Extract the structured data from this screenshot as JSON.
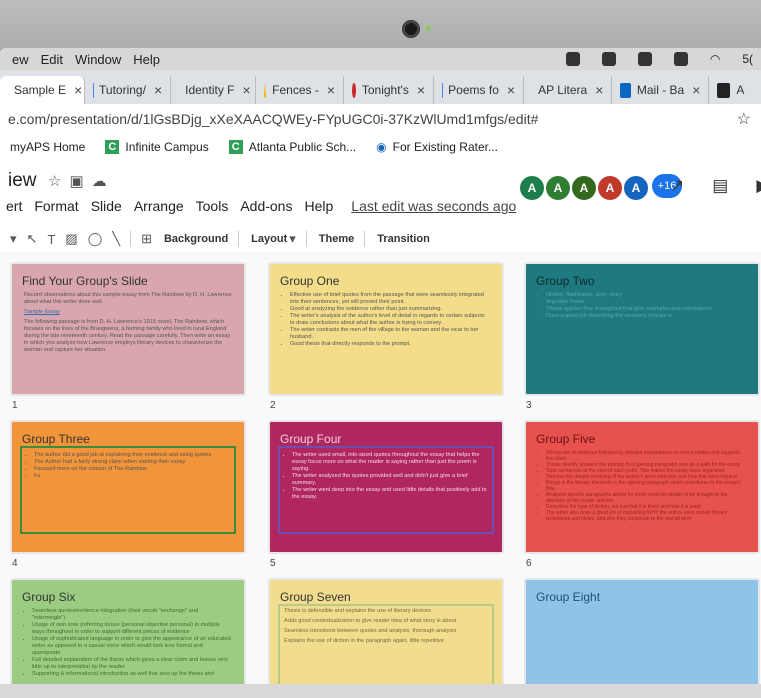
{
  "menubar": {
    "items": [
      "ew",
      "Edit",
      "Window",
      "Help"
    ],
    "battery": "5("
  },
  "tabs": [
    {
      "label": "Sample E",
      "close": "×",
      "color": "#e8a23a",
      "active": true
    },
    {
      "label": "Tutoring/",
      "close": "×",
      "color": "#4285f4"
    },
    {
      "label": "Identity F",
      "close": "×",
      "color": "#4285f4"
    },
    {
      "label": "Fences -",
      "close": "×",
      "color": "#f4b400"
    },
    {
      "label": "Tonight's",
      "close": "×",
      "color": "#c62828"
    },
    {
      "label": "Poems fo",
      "close": "×",
      "color": "#4285f4"
    },
    {
      "label": "AP Litera",
      "close": "×",
      "color": "#4285f4"
    },
    {
      "label": "Mail - Ba",
      "close": "×",
      "color": "#0a66c2"
    },
    {
      "label": "A",
      "close": "",
      "color": "#222222"
    }
  ],
  "address": {
    "url": "e.com/presentation/d/1lGsBDjg_xXeXAACQWEy-FYpUGC0i-37KzWlUmd1mfgs/edit#",
    "star": "☆"
  },
  "bookmarks": [
    {
      "label": "myAPS Home",
      "icon": ""
    },
    {
      "label": "Infinite Campus",
      "icon": "C"
    },
    {
      "label": "Atlanta Public Sch...",
      "icon": "C"
    },
    {
      "label": "For Existing Rater...",
      "icon": "◉"
    }
  ],
  "slides_header": {
    "title": "iew",
    "menu": [
      "ert",
      "Format",
      "Slide",
      "Arrange",
      "Tools",
      "Add-ons",
      "Help"
    ],
    "last_edit": "Last edit was seconds ago",
    "avatars": [
      {
        "initial": "A",
        "color": "#1e7e4a"
      },
      {
        "initial": "A",
        "color": "#2e7d32"
      },
      {
        "initial": "A",
        "color": "#33691e"
      },
      {
        "initial": "A",
        "color": "#c0392b"
      },
      {
        "initial": "A",
        "color": "#1565c0"
      }
    ],
    "more_collaborators": "+16"
  },
  "toolbar": {
    "background": "Background",
    "layout": "Layout",
    "theme": "Theme",
    "transition": "Transition"
  },
  "slides": [
    {
      "num": "1",
      "title": "Find Your Group's Slide",
      "color": "#d9a6ae",
      "text": [
        "Record observations about this sample essay from The Rainbow by D. H. Lawrence about what this writer does well.",
        "Sample Essay",
        "The following passage is from D. H. Lawrence's 1915 novel, The Rainbow, which focuses on the lives of the Brangwens, a farming family who lived in rural England during the late nineteenth century. Read the passage carefully. Then write an essay in which you analyze how Lawrence employs literary devices to characterize the woman and capture her situation."
      ]
    },
    {
      "num": "2",
      "title": "Group One",
      "color": "#f3dc8a",
      "bullets": [
        "Effective use of brief quotes from the passage that were seamlessly integrated into their sentences, yet still proved their point.",
        "Good at analyzing the evidence rather than just summarizing.",
        "The writer's analysis of the author's level of detail in regards to certain subjects to draw conclusions about what the author is trying to convey.",
        "The writer contrasts the men of the village to the woman and the vicar to her husband.",
        "Good thesis that directly responds to the prompt."
      ]
    },
    {
      "num": "3",
      "title": "Group Two",
      "color": "#1f7a80",
      "bullets": [
        "Diction, flashbacks, tone, story",
        "Arguable thesis",
        "Thesis applies flow throughout that give examples and conclusions",
        "Does a good job describing the woman's change in"
      ]
    },
    {
      "num": "4",
      "title": "Group Three",
      "color": "#f2953a",
      "bullets": [
        "The author did a good job at explaining their evidence and using quotes",
        "The Author had a fairly strong claim when starting their essay",
        "Focused more on the citation of The Rainbow",
        "Fu"
      ]
    },
    {
      "num": "5",
      "title": "Group Four",
      "color": "#b0265e",
      "bullets": [
        "The writer used small, into-sized quotes throughout the essay that helps the essay focus more on what the reader is saying rather than just the poem is saying.",
        "The writer analyzed the quotes provided well and didn't just give a brief summary.",
        "The writer went deep into the essay and used little details that positively add to the essay."
      ]
    },
    {
      "num": "6",
      "title": "Group Five",
      "color": "#e8524e",
      "bullets": [
        "Strong use of evidence followed by detailed explanations on how it relates and supports the claim",
        "Thesis directly answers the prompt, first opening paragraph sets up a path for the essay",
        "Topic sentences at the start of each point. This makes the essay more organized",
        "Touches the deeper meaning of the author's word selection and how that word impacts",
        "Brings in the literary elements in the opening paragraph which contributes to the essay's flow",
        "Analyzes specific paragraphs allows for more concrete details to be brought to the attention of the reader and the",
        "Describes the type of diction, not just that it is there and how it is used",
        "The writer also does a great job of explaining WHY the author uses certain literary techniques and styles, and why they contribute to the overall story"
      ]
    },
    {
      "num": "",
      "title": "Group Six",
      "color": "#9ccc82",
      "bullets": [
        "Seamless quotes/evidence integration (their vocab \"exchange\" and \"intermingle\")",
        "Usage of own tone (referring to/use (personal objective personal) in multiple ways throughout in order to support different pieces of evidence",
        "Usage of sophisticated language in order to give the appearance of an educated writer as opposed to a casual voice which would look less formal and appropriate",
        "Full detailed explanation of the thesis which gives a clear claim and leaves very little up to interpretation by the reader",
        "Supporting & informational introduction as well that sets up the thesis and"
      ]
    },
    {
      "num": "",
      "title": "Group Seven",
      "color": "#f2dd8e",
      "bullets": [
        "Thesis is defensible and explains the use of literary devices",
        "Adds good contextualization to give reader idea of what story is about",
        "Seamless transitions between quotes and analysis, thorough analysis",
        "Explains the use of diction in the paragraph again, little repetitive"
      ]
    },
    {
      "num": "",
      "title": "Group Eight",
      "color": "#8fc3ea",
      "bullets": []
    }
  ]
}
